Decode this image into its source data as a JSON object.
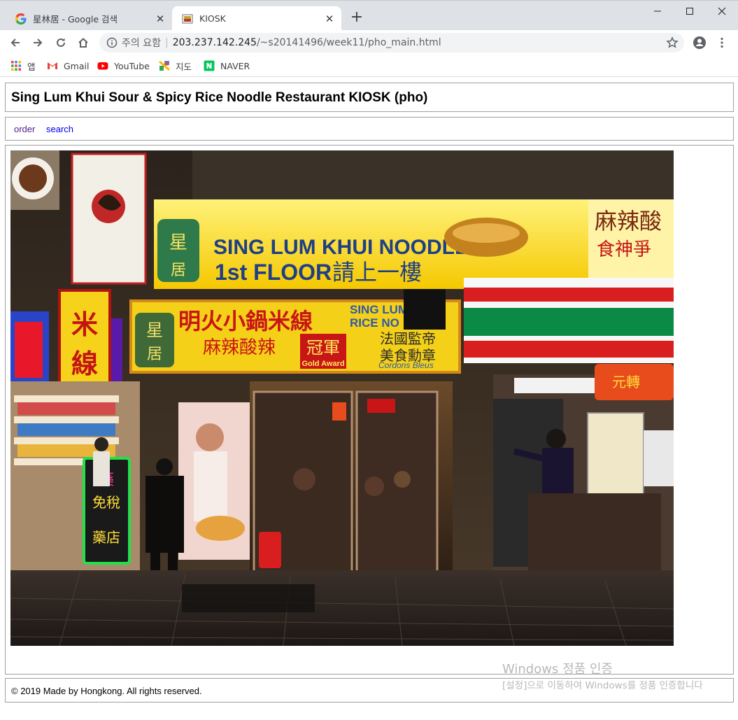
{
  "browser": {
    "tabs": [
      {
        "title": "星林居 - Google 검색",
        "favicon": "google-g-icon",
        "active": false
      },
      {
        "title": "KIOSK",
        "favicon": "page-favicon",
        "active": true
      }
    ],
    "close_glyph": "✕",
    "newtab_glyph": "+",
    "address": {
      "security_text": "주의 요함",
      "separator": "|",
      "host": "203.237.142.245",
      "path": "/~s20141496/week11/pho_main.html"
    },
    "bookmarks": [
      {
        "label": "앱",
        "icon": "apps-grid-icon"
      },
      {
        "label": "Gmail",
        "icon": "gmail-icon"
      },
      {
        "label": "YouTube",
        "icon": "youtube-icon"
      },
      {
        "label": "지도",
        "icon": "maps-icon"
      },
      {
        "label": "NAVER",
        "icon": "naver-icon"
      }
    ]
  },
  "page": {
    "title": "Sing Lum Khui Sour & Spicy Rice Noodle Restaurant KIOSK (pho)",
    "nav": [
      {
        "label": "order",
        "color": "#551a8b"
      },
      {
        "label": "search",
        "color": "#0000ee"
      }
    ],
    "photo_alt": "Storefront of Sing Lum Khui Noodle restaurant at night",
    "footer": "© 2019 Made by Hongkong. All rights reserved."
  },
  "watermark": {
    "line1": "Windows 정품 인증",
    "line2": "[설정]으로 이동하여 Windows를 정품 인증합니다"
  }
}
